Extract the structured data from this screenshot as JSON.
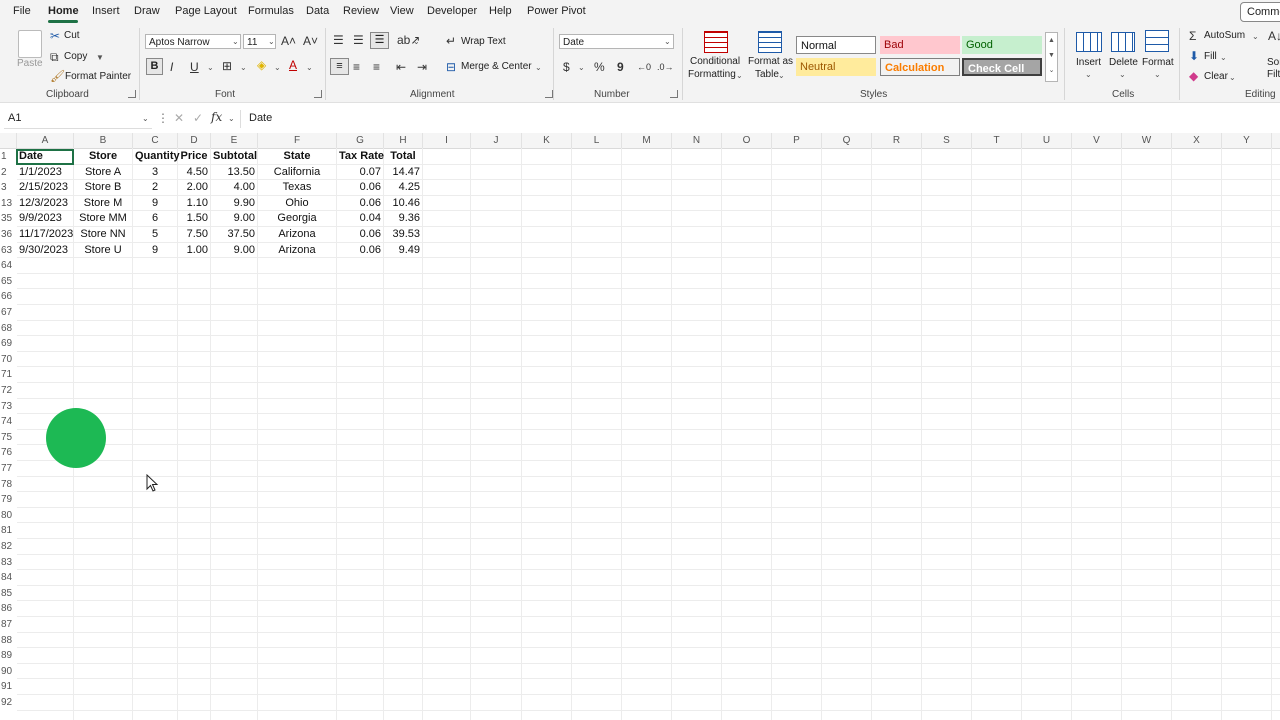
{
  "menu": {
    "items": [
      "File",
      "Home",
      "Insert",
      "Draw",
      "Page Layout",
      "Formulas",
      "Data",
      "Review",
      "View",
      "Developer",
      "Help",
      "Power Pivot"
    ],
    "active": "Home",
    "comments_label": "Comments"
  },
  "ribbon": {
    "clipboard": {
      "paste": "Paste",
      "cut": "Cut",
      "copy": "Copy",
      "format_painter": "Format Painter",
      "label": "Clipboard"
    },
    "font": {
      "name": "Aptos Narrow",
      "size": "11",
      "bold": "B",
      "italic": "I",
      "underline": "U",
      "label": "Font"
    },
    "alignment": {
      "wrap": "Wrap Text",
      "merge": "Merge & Center",
      "label": "Alignment"
    },
    "number": {
      "format": "Date",
      "currency": "$",
      "percent": "%",
      "comma": "9",
      "label": "Number"
    },
    "styles": {
      "conditional": [
        "Conditional",
        "Formatting"
      ],
      "format_table": [
        "Format as",
        "Table"
      ],
      "normal": "Normal",
      "bad": "Bad",
      "good": "Good",
      "neutral": "Neutral",
      "calculation": "Calculation",
      "check": "Check Cell",
      "label": "Styles"
    },
    "cells": {
      "insert": "Insert",
      "delete": "Delete",
      "format": "Format",
      "label": "Cells"
    },
    "editing": {
      "autosum": "AutoSum",
      "fill": "Fill",
      "clear": "Clear",
      "sort": "Sor",
      "filt": "Filt",
      "label": "Editing"
    }
  },
  "formula_bar": {
    "name_box": "A1",
    "fx": "fx",
    "content": "Date"
  },
  "sheet": {
    "columns": [
      "A",
      "B",
      "C",
      "D",
      "E",
      "F",
      "G",
      "H",
      "I",
      "J",
      "K",
      "L",
      "M",
      "N",
      "O",
      "P",
      "Q",
      "R",
      "S",
      "T",
      "U",
      "V",
      "W",
      "X",
      "Y"
    ],
    "headers": [
      "Date",
      "Store",
      "Quantity",
      "Price",
      "Subtotal",
      "State",
      "Tax Rate",
      "Total"
    ],
    "row_numbers": [
      "1",
      "2",
      "3",
      "13",
      "35",
      "36",
      "63",
      "64",
      "65",
      "66",
      "67",
      "68",
      "69",
      "70",
      "71",
      "72",
      "73",
      "74",
      "75",
      "76",
      "77",
      "78",
      "79",
      "80",
      "81",
      "82",
      "83",
      "84",
      "85",
      "86",
      "87",
      "88",
      "89",
      "90",
      "91",
      "92"
    ],
    "rows": [
      [
        "1/1/2023",
        "Store A",
        "3",
        "4.50",
        "13.50",
        "California",
        "0.07",
        "14.47"
      ],
      [
        "2/15/2023",
        "Store B",
        "2",
        "2.00",
        "4.00",
        "Texas",
        "0.06",
        "4.25"
      ],
      [
        "12/3/2023",
        "Store M",
        "9",
        "1.10",
        "9.90",
        "Ohio",
        "0.06",
        "10.46"
      ],
      [
        "9/9/2023",
        "Store MM",
        "6",
        "1.50",
        "9.00",
        "Georgia",
        "0.04",
        "9.36"
      ],
      [
        "11/17/2023",
        "Store NN",
        "5",
        "7.50",
        "37.50",
        "Arizona",
        "0.06",
        "39.53"
      ],
      [
        "9/30/2023",
        "Store U",
        "9",
        "1.00",
        "9.00",
        "Arizona",
        "0.06",
        "9.49"
      ]
    ]
  },
  "colors": {
    "accent": "#1e7145",
    "cursor_dot": "#1db954",
    "bad_bg": "#ffc7ce",
    "good_bg": "#c6efce",
    "neutral_bg": "#ffeb9c"
  }
}
